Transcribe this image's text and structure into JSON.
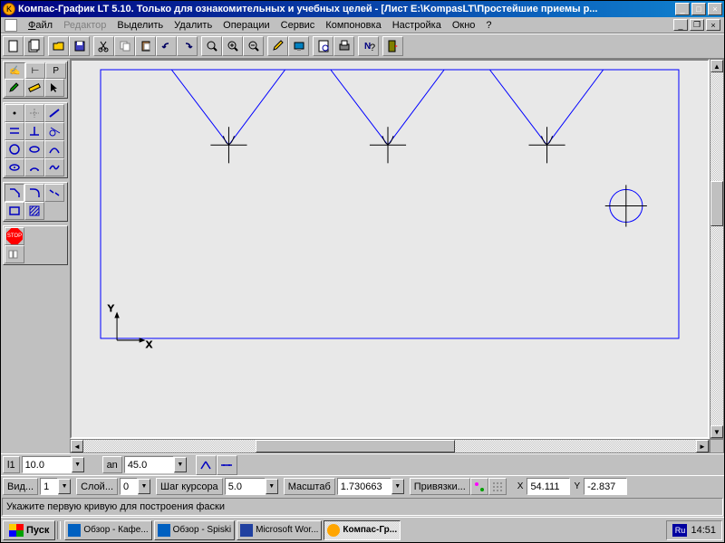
{
  "window": {
    "title": "Компас-График LT 5.10. Только для ознакомительных и учебных целей - [Лист E:\\KompasLT\\Простейшие приемы р..."
  },
  "menu": {
    "file": "Файл",
    "edit": "Редактор",
    "select": "Выделить",
    "delete": "Удалить",
    "operations": "Операции",
    "service": "Сервис",
    "layout": "Компоновка",
    "settings": "Настройка",
    "window": "Окно",
    "help": "?"
  },
  "tabs": {
    "t1": "▲",
    "t2": "⊢",
    "t3": "P"
  },
  "params": {
    "l1_label": "l1",
    "l1_value": "10.0",
    "an_label": "an",
    "an_value": "45.0"
  },
  "status": {
    "view_label": "Вид...",
    "view_value": "1",
    "layer_label": "Слой...",
    "layer_value": "0",
    "cursor_label": "Шаг курсора",
    "cursor_value": "5.0",
    "scale_label": "Масштаб",
    "scale_value": "1.730663",
    "snap_label": "Привязки...",
    "x_label": "X",
    "x_value": "54.111",
    "y_label": "Y",
    "y_value": "-2.837"
  },
  "info": {
    "prompt": "Укажите первую кривую для построения фаски"
  },
  "taskbar": {
    "start": "Пуск",
    "task1": "Обзор - Кафе...",
    "task2": "Обзор - Spiski",
    "task3": "Microsoft Wor...",
    "task4": "Компас-Гр...",
    "lang": "Ru",
    "time": "14:51"
  },
  "icons": {
    "stop": "STOP"
  },
  "axes": {
    "x": "X",
    "y": "Y"
  }
}
